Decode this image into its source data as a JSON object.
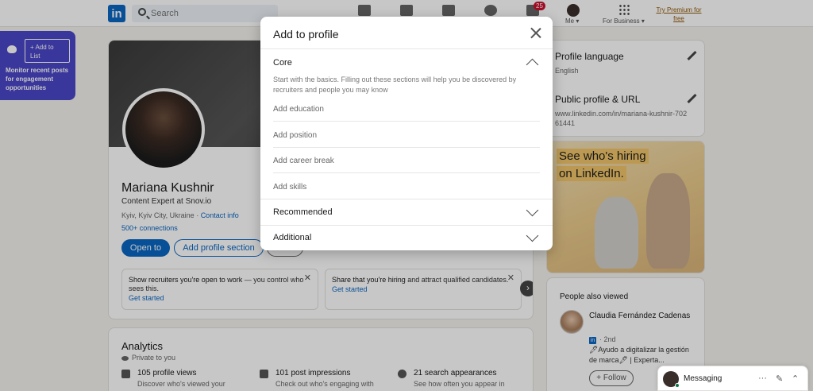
{
  "nav": {
    "logo": "in",
    "search_placeholder": "Search",
    "notifications_badge": "25",
    "me_label": "Me ▾",
    "business_label": "For Business ▾",
    "premium": "Try Premium for free"
  },
  "snov_widget": {
    "add_to_list": "+ Add to List",
    "monitor_text": "Monitor recent posts for engagement opportunities"
  },
  "profile": {
    "name": "Mariana Kushnir",
    "headline": "Content Expert at Snov.io",
    "location": "Kyiv, Kyiv City, Ukraine",
    "contact_info": "Contact info",
    "connections": "500+ connections",
    "open_to": "Open to",
    "add_profile_section": "Add profile section"
  },
  "promos": [
    {
      "bold": "Show recruiters you're open to work",
      "rest": " — you control who sees this.",
      "link": "Get started"
    },
    {
      "bold": "Share that you're hiring",
      "rest": " and attract qualified candidates.",
      "link": "Get started"
    }
  ],
  "analytics": {
    "title": "Analytics",
    "privacy": "Private to you",
    "metrics": [
      {
        "title": "105 profile views",
        "sub": "Discover who's viewed your"
      },
      {
        "title": "101 post impressions",
        "sub": "Check out who's engaging with"
      },
      {
        "title": "21 search appearances",
        "sub": "See how often you appear in"
      }
    ]
  },
  "right": {
    "profile_language_title": "Profile language",
    "profile_language_value": "English",
    "public_url_title": "Public profile & URL",
    "public_url_value": "www.linkedin.com/in/mariana-kushnir-70261441",
    "ad_line1": "See who's hiring",
    "ad_line2": "on LinkedIn.",
    "people_also_viewed": "People also viewed",
    "pav_name": "Claudia Fernández Cadenas",
    "pav_degree": "· 2nd",
    "pav_desc": "🖊Ayudo a digitalizar la gestión de marca🖊 | Experta...",
    "follow": "+ Follow"
  },
  "modal": {
    "title": "Add to profile",
    "core_title": "Core",
    "core_desc": "Start with the basics. Filling out these sections will help you be discovered by recruiters and people you may know",
    "core_items": [
      "Add education",
      "Add position",
      "Add career break",
      "Add skills"
    ],
    "recommended": "Recommended",
    "additional": "Additional"
  },
  "messaging": {
    "label": "Messaging",
    "more": "···",
    "compose": "✎",
    "collapse": "⌃"
  }
}
